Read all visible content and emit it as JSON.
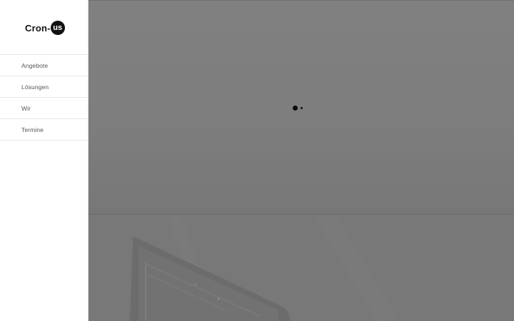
{
  "brand": {
    "name": "Cron-",
    "badge": "us"
  },
  "nav": {
    "items": [
      {
        "label": "Angebote"
      },
      {
        "label": "Lösungen"
      },
      {
        "label": "Wir"
      },
      {
        "label": "Termine"
      }
    ]
  },
  "colors": {
    "sidebar_bg": "#ffffff",
    "hero_bg": "#808080",
    "text": "#555555",
    "brand": "#111111"
  },
  "icons": {
    "loader": "loading-dots-icon"
  }
}
